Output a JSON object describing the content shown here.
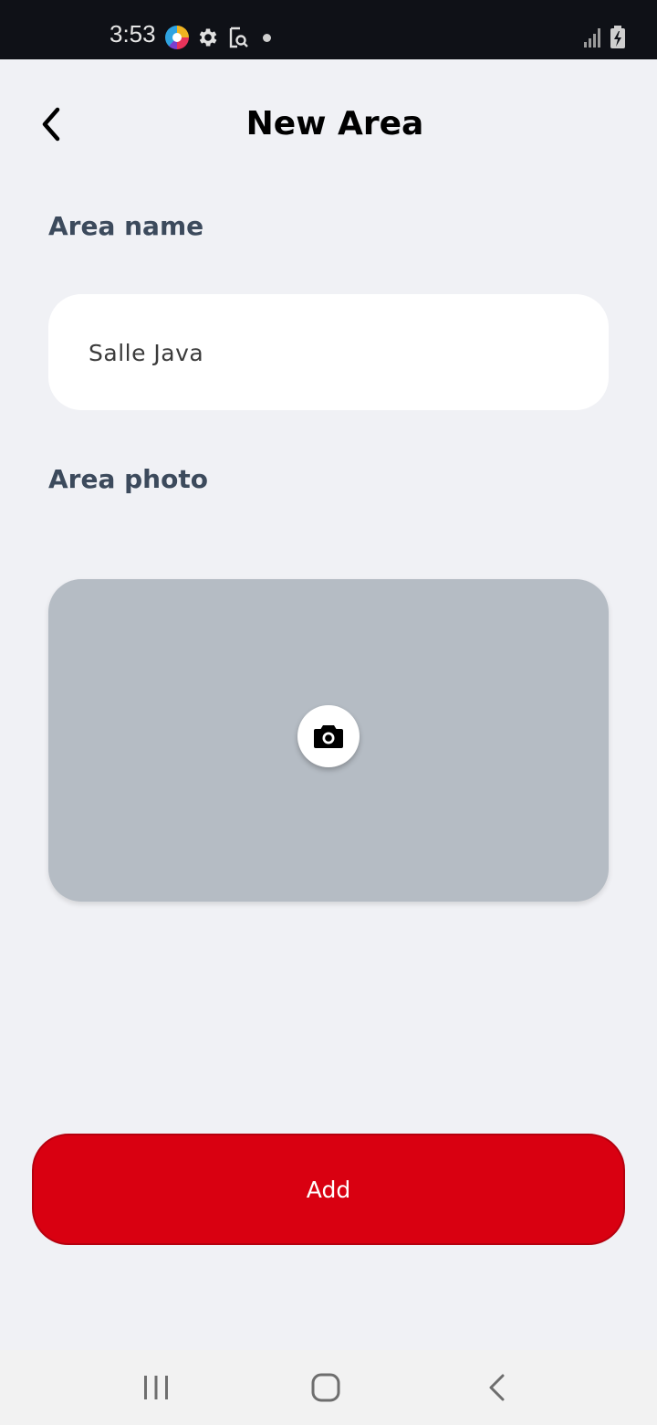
{
  "status_bar": {
    "time": "3:53",
    "icons": [
      "app-notification-icon",
      "gear-icon",
      "screenshot-search-icon",
      "dot-icon",
      "signal-icon",
      "battery-charging-icon"
    ]
  },
  "header": {
    "title": "New Area",
    "back_icon": "chevron-left-icon"
  },
  "form": {
    "name_label": "Area name",
    "name_value": "Salle Java",
    "photo_label": "Area photo",
    "photo_icon": "camera-icon"
  },
  "actions": {
    "add_label": "Add"
  },
  "nav_bar": {
    "icons": [
      "recent-apps-icon",
      "home-icon",
      "back-icon"
    ]
  },
  "colors": {
    "background": "#f0f1f5",
    "status_bar": "#0f1117",
    "label": "#3c4a5c",
    "photo_placeholder": "#b5bcc4",
    "accent": "#d90011"
  }
}
